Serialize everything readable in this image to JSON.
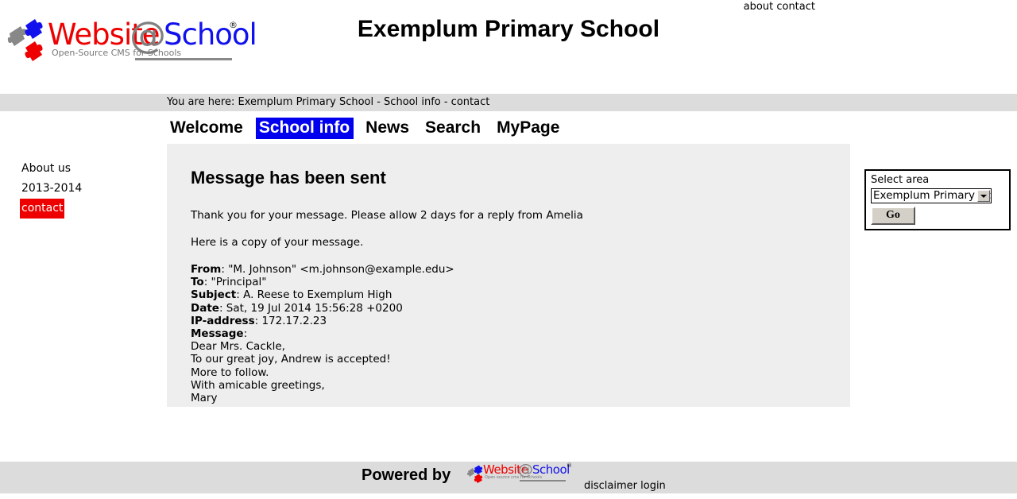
{
  "top_links": {
    "about": "about",
    "contact": "contact"
  },
  "header": {
    "school_title": "Exemplum Primary School",
    "logo": {
      "website": "Website",
      "at": "@",
      "school": "School",
      "registered": "®",
      "tagline": "Open-Source CMS for Schools"
    }
  },
  "breadcrumb": {
    "text": "You are here: Exemplum Primary School - School info - contact"
  },
  "main_menu": {
    "items": [
      {
        "label": "Welcome",
        "active": false
      },
      {
        "label": "School info",
        "active": true
      },
      {
        "label": "News",
        "active": false
      },
      {
        "label": "Search",
        "active": false
      },
      {
        "label": "MyPage",
        "active": false
      }
    ],
    "active_bg": "#0000ee",
    "active_fg": "#ffffff"
  },
  "sidebar": {
    "items": [
      {
        "label": "About us",
        "active": false
      },
      {
        "label": "2013-2014",
        "active": false
      },
      {
        "label": "contact",
        "active": true
      }
    ],
    "active_bg": "#ee0000",
    "active_fg": "#ffffff"
  },
  "content": {
    "heading": "Message has been sent",
    "paragraph_1": "Thank you for your message. Please allow 2 days for a reply from Amelia",
    "paragraph_2": "Here is a copy of your message.",
    "mail": {
      "from_label": "From",
      "from_value": ": \"M. Johnson\" <m.johnson@example.edu>",
      "to_label": "To",
      "to_value": ": \"Principal\"",
      "subject_label": "Subject",
      "subject_value": ": A. Reese to Exemplum High",
      "date_label": "Date",
      "date_value": ": Sat, 19 Jul 2014 15:56:28 +0200",
      "ip_label": "IP-address",
      "ip_value": ": 172.17.2.23",
      "message_label": "Message",
      "message_value": ":",
      "body_lines": [
        "Dear Mrs. Cackle,",
        "To our great joy, Andrew is accepted!",
        "More to follow.",
        "With amicable greetings,",
        "Mary"
      ]
    }
  },
  "select_area": {
    "label": "Select area",
    "selected_option": "Exemplum Primary Scl",
    "options": [
      "Exemplum Primary School"
    ],
    "go_button": "Go",
    "dropdown_icon": "chevron-down-icon"
  },
  "footer": {
    "powered_by": "Powered by",
    "logo": {
      "website": "Website",
      "at": "@",
      "school": "School",
      "registered": "®",
      "tagline": "Open source cms for schools"
    },
    "links": {
      "disclaimer": "disclaimer",
      "login": "login"
    }
  }
}
